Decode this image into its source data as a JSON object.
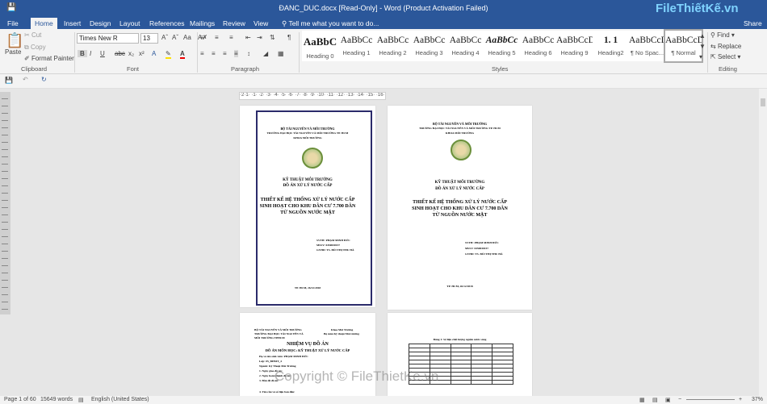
{
  "window": {
    "title": "ĐANC_DUC.docx [Read-Only] - Word (Product Activation Failed)"
  },
  "tabs": [
    "File",
    "Home",
    "Insert",
    "Design",
    "Layout",
    "References",
    "Mailings",
    "Review",
    "View"
  ],
  "tell_me": "Tell me what you want to do...",
  "share": "Share",
  "brand": "FileThiếtKế.vn",
  "clipboard": {
    "paste": "Paste",
    "cut": "Cut",
    "copy": "Copy",
    "format_painter": "Format Painter",
    "label": "Clipboard"
  },
  "font": {
    "name": "Times New R",
    "size": "13",
    "label": "Font"
  },
  "paragraph": {
    "label": "Paragraph"
  },
  "styles": {
    "label": "Styles",
    "items": [
      {
        "preview": "AaBbC",
        "name": "Heading 0"
      },
      {
        "preview": "AaBbCc",
        "name": "Heading 1"
      },
      {
        "preview": "AaBbCc",
        "name": "Heading 2"
      },
      {
        "preview": "AaBbCc",
        "name": "Heading 3"
      },
      {
        "preview": "AaBbCc",
        "name": "Heading 4"
      },
      {
        "preview": "AaBbCc",
        "name": "Heading 5"
      },
      {
        "preview": "AaBbCc",
        "name": "Heading 6"
      },
      {
        "preview": "AaBbCcDd",
        "name": "Heading 9"
      },
      {
        "preview": "1. 1",
        "name": "Heading2"
      },
      {
        "preview": "AaBbCcDd",
        "name": "¶ No Spac..."
      },
      {
        "preview": "AaBbCcDd",
        "name": "¶ Normal"
      }
    ]
  },
  "editing": {
    "find": "Find",
    "replace": "Replace",
    "select": "Select",
    "label": "Editing"
  },
  "ruler": "·2·1· ·1· ·2· ·3· ·4· ·5· ·6· ·7· ·8· ·9· ·10· ·11· ·12· ·13· ·14· ·15· ·16·",
  "page1": {
    "ministry": "BỘ TÀI NGUYÊN VÀ MÔI TRƯỜNG",
    "school": "TRƯỜNG ĐẠI HỌC TÀI NGUYÊN VÀ MÔI TRƯỜNG TP. HCM",
    "faculty": "KHOA MÔI TRƯỜNG",
    "major": "KỸ THUẬT MÔI TRƯỜNG",
    "project": "ĐỒ ÁN XỬ LÝ NƯỚC CẤP",
    "title1": "THIẾT KẾ HỆ THỐNG XỬ LÝ NƯỚC CẤP",
    "title2": "SINH HOẠT CHO KHU DÂN CƯ 7.700 DÂN",
    "title3": "TỪ NGUỒN NƯỚC MẶT",
    "student": "SVTH: PHẠM MINH ĐỨC",
    "mssv": "MSSV: 0450030157",
    "advisor": "GVHD: TS. BÙI THỊ THU HÀ",
    "date": "TP. HCM, 26/12/2018"
  },
  "page3": {
    "ministry": "BỘ TÀI NGUYÊN VÀ MÔI TRƯỜNG",
    "school": "TRƯỜNG ĐẠI HỌC TÀI NGUYÊN VÀ",
    "school2": "MÔI TRƯỜNG TPHCM",
    "faculty": "Khoa Môi Trường",
    "dept": "Bộ môn Kỹ thuật Môi trường",
    "heading": "NHIỆM VỤ ĐỒ ÁN",
    "subject": "ĐỒ ÁN MÔN HỌC: KỸ THUẬT XỬ LÝ NƯỚC CẤP",
    "l1": "Họ và tên sinh viên: PHẠM MINH ĐỨC",
    "l2": "Lớp: 05_ĐHMT_4",
    "l3": "Ngành: Kỹ Thuật Môi Trường",
    "l4": "1. Ngày giao đồ án:",
    "l5": "2. Ngày hoàn thành đồ án:",
    "l6": "3. Đầu đề đồ án:",
    "l7": "4. Yêu cầu và số liệu ban đầu:"
  },
  "page4": {
    "caption": "Bảng 1: Số liệu chất lượng nguồn nước sông"
  },
  "watermark": "Copyright © FileThietKe.vn",
  "status": {
    "page": "Page 1 of 60",
    "words": "15649 words",
    "language": "English (United States)",
    "zoom": "37%"
  }
}
